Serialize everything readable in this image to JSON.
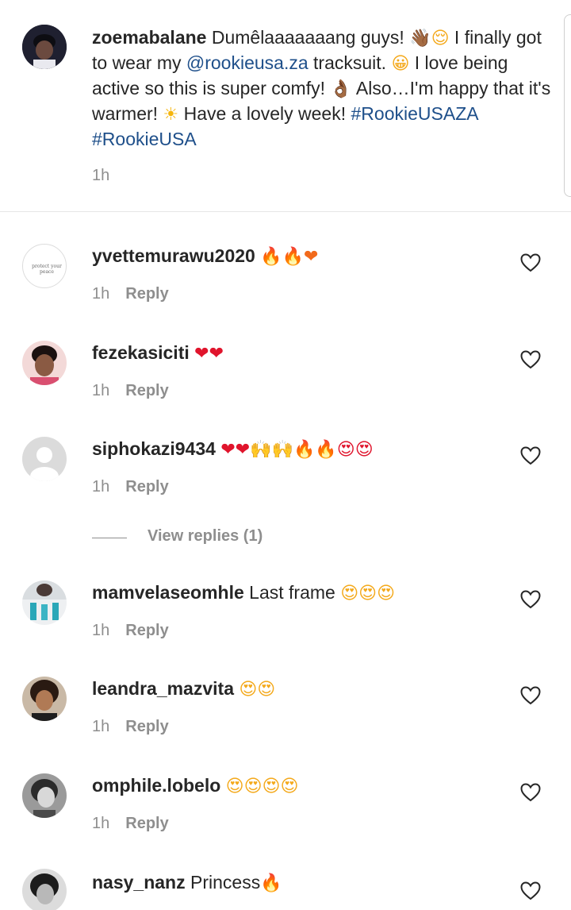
{
  "caption": {
    "username": "zoemabalane",
    "text_1": "Dumêlaaaaaaang guys! ",
    "text_2": " I finally got to wear my ",
    "mention": "@rookieusa.za",
    "text_3": " tracksuit. ",
    "text_4": " I love being active so this is super comfy! ",
    "text_5": " Also…I'm happy that it's warmer! ",
    "text_6": " Have a lovely week! ",
    "hashtags": "#RookieUSAZA #RookieUSA",
    "time": "1h",
    "emojis": {
      "wave": "👋🏾",
      "smile": "😌",
      "grin": "😀",
      "ok": "👌🏾",
      "sun": "☀"
    }
  },
  "comments": [
    {
      "username": "yvettemurawu2020",
      "text": "",
      "emojis": "🔥🔥❤",
      "time": "1h",
      "reply": "Reply",
      "avatar_text": "protect your peace"
    },
    {
      "username": "fezekasiciti",
      "text": "",
      "emojis": "❤❤",
      "time": "1h",
      "reply": "Reply"
    },
    {
      "username": "siphokazi9434",
      "text": "",
      "emojis": "❤❤🙌🙌🔥🔥😍😍",
      "time": "1h",
      "reply": "Reply"
    },
    {
      "username": "mamvelaseomhle",
      "text": "Last frame",
      "emojis": "😍😍😍",
      "time": "1h",
      "reply": "Reply"
    },
    {
      "username": "leandra_mazvita",
      "text": "",
      "emojis": "😍😍",
      "time": "1h",
      "reply": "Reply"
    },
    {
      "username": "omphile.lobelo",
      "text": "",
      "emojis": "😍😍😍😍",
      "time": "1h",
      "reply": "Reply"
    },
    {
      "username": "nasy_nanz",
      "text": "Princess",
      "emojis": "🔥",
      "time": "",
      "reply": ""
    }
  ],
  "view_replies": "View replies (1)",
  "colors": {
    "link": "#1e4f8a",
    "text": "#262626",
    "muted": "#8e8e8e"
  }
}
